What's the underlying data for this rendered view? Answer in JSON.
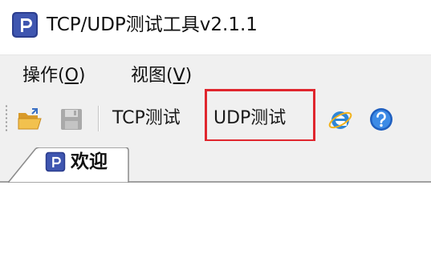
{
  "window": {
    "title": "TCP/UDP测试工具v2.1.1",
    "icon": "app-logo-icon"
  },
  "menubar": {
    "items": [
      {
        "label_prefix": "操作(",
        "mnemonic": "O",
        "label_suffix": ")"
      },
      {
        "label_prefix": "视图(",
        "mnemonic": "V",
        "label_suffix": ")"
      }
    ]
  },
  "toolbar": {
    "open_icon": "folder-open-icon",
    "save_icon": "save-disk-icon",
    "tcp_label": "TCP测试",
    "udp_label": "UDP测试",
    "browser_icon": "internet-explorer-icon",
    "help_icon": "help-icon",
    "highlight_color": "#e0262e"
  },
  "tabs": [
    {
      "label": "欢迎",
      "icon": "app-logo-icon",
      "active": true
    }
  ]
}
